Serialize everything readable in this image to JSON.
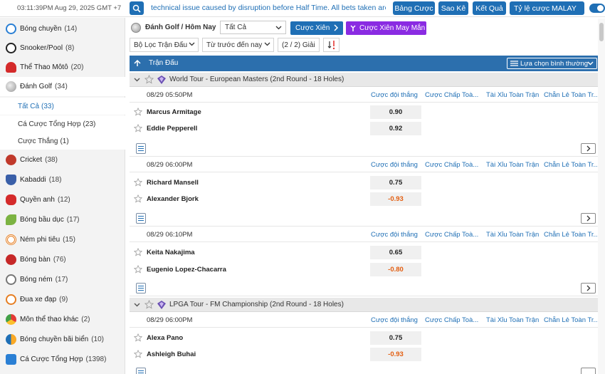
{
  "topbar": {
    "time": "03:11:39PM Aug 29, 2025 GMT +7",
    "ticker": "technical issue caused by disruption before Half Time. All bets taken are",
    "buttons": [
      "Bảng Cược",
      "Sao Kê",
      "Kết Quả"
    ],
    "odds_type": "Tỷ lệ cược MALAY"
  },
  "sidebar": {
    "items": [
      {
        "label": "Bóng chuyền",
        "count": "(14)",
        "icon": "volleyball-icon",
        "color": "#2a7fd4"
      },
      {
        "label": "Snooker/Pool",
        "count": "(8)",
        "icon": "snooker-icon",
        "color": "#222222"
      },
      {
        "label": "Thể Thao Môtô",
        "count": "(20)",
        "icon": "motorsport-icon",
        "color": "#d42a2a"
      },
      {
        "label": "Đánh Golf",
        "count": "(34)",
        "icon": "golf-icon",
        "color": "#999999"
      },
      {
        "label": "Cricket",
        "count": "(38)",
        "icon": "cricket-icon",
        "color": "#c0392b"
      },
      {
        "label": "Kabaddi",
        "count": "(18)",
        "icon": "kabaddi-icon",
        "color": "#3a5fa8"
      },
      {
        "label": "Quyền anh",
        "count": "(12)",
        "icon": "boxing-icon",
        "color": "#d42a2a"
      },
      {
        "label": "Bóng bầu dục",
        "count": "(17)",
        "icon": "rugby-icon",
        "color": "#7cb342"
      },
      {
        "label": "Ném phi tiêu",
        "count": "(15)",
        "icon": "darts-icon",
        "color": "#e67e22"
      },
      {
        "label": "Bóng bàn",
        "count": "(76)",
        "icon": "table-tennis-icon",
        "color": "#c62828"
      },
      {
        "label": "Bóng ném",
        "count": "(17)",
        "icon": "handball-icon",
        "color": "#777777"
      },
      {
        "label": "Đua xe đạp",
        "count": "(9)",
        "icon": "cycling-icon",
        "color": "#e67e22"
      },
      {
        "label": "Môn thể thao khác",
        "count": "(2)",
        "icon": "other-sports-icon",
        "color": "#e53935"
      },
      {
        "label": "Bóng chuyền bãi biển",
        "count": "(10)",
        "icon": "beach-volleyball-icon",
        "color": "#f9a825"
      },
      {
        "label": "Cá Cược Tổng Hợp",
        "count": "(1398)",
        "icon": "parlay-icon",
        "color": "#2a7fd4"
      }
    ],
    "subitems": [
      {
        "label": "Tất Cả",
        "count": "(33)"
      },
      {
        "label": "Cá Cược Tổng Hợp",
        "count": "(23)"
      },
      {
        "label": "Cược Thắng",
        "count": "(1)"
      }
    ]
  },
  "main": {
    "title": "Đánh Golf / Hôm Nay",
    "filter_select": "Tất Cả",
    "parlay_button": "Cược Xiên",
    "lucky_button": "Cược Xiên May Mắn",
    "league_filter": "Bộ Lọc Trận Đấu",
    "sort_filter": "Từ trước đến nay",
    "pager": "(2 / 2) Giải",
    "table_header": "Trận Đấu",
    "view_select": "Lựa chọn bình thường",
    "columns": [
      "Cược đội thắng",
      "Cược Chấp Toà...",
      "Tài Xỉu Toàn Trận",
      "Chẵn Lẻ Toàn Tr..."
    ],
    "leagues": [
      {
        "name": "World Tour - European Masters (2nd Round - 18 Holes)",
        "matches": [
          {
            "time": "08/29 05:50PM",
            "teams": [
              {
                "name": "Marcus Armitage",
                "odd": "0.90"
              },
              {
                "name": "Eddie Pepperell",
                "odd": "0.92"
              }
            ]
          },
          {
            "time": "08/29 06:00PM",
            "teams": [
              {
                "name": "Richard Mansell",
                "odd": "0.75"
              },
              {
                "name": "Alexander Bjork",
                "odd": "-0.93"
              }
            ]
          },
          {
            "time": "08/29 06:10PM",
            "teams": [
              {
                "name": "Keita Nakajima",
                "odd": "0.65"
              },
              {
                "name": "Eugenio Lopez-Chacarra",
                "odd": "-0.80"
              }
            ]
          }
        ]
      },
      {
        "name": "LPGA Tour - FM Championship (2nd Round - 18 Holes)",
        "matches": [
          {
            "time": "08/29 06:00PM",
            "teams": [
              {
                "name": "Alexa Pano",
                "odd": "0.75"
              },
              {
                "name": "Ashleigh Buhai",
                "odd": "-0.93"
              }
            ]
          }
        ]
      }
    ]
  },
  "colors": {
    "primary": "#1f6fb5",
    "header": "#2c6fad",
    "purple": "#8a2be2",
    "negative": "#e35d0f"
  }
}
